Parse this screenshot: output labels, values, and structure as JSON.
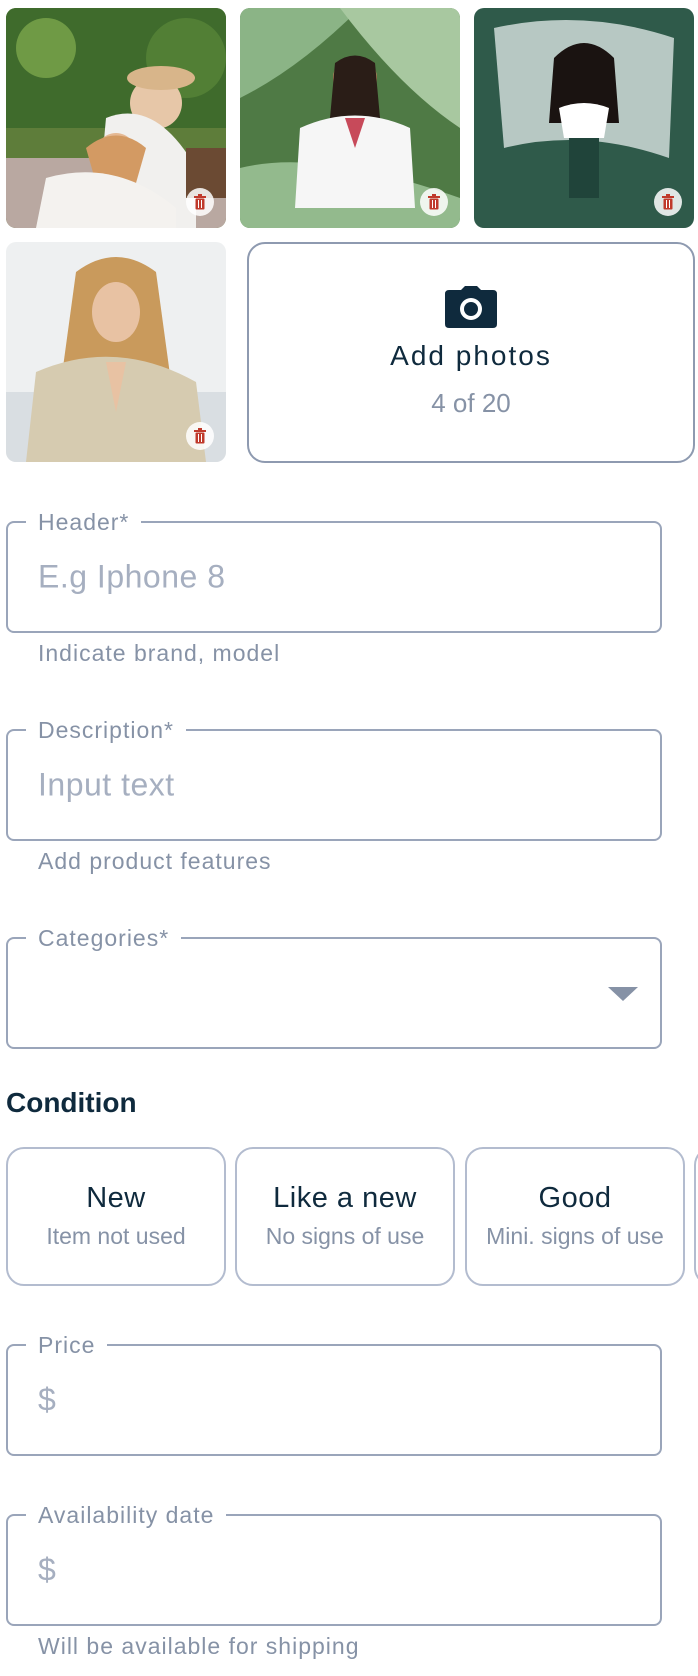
{
  "photos": [
    {
      "alt": "two women picnic",
      "delete_icon": "trash-icon"
    },
    {
      "alt": "woman in white shirt among leaves",
      "delete_icon": "trash-icon"
    },
    {
      "alt": "woman floating in water",
      "delete_icon": "trash-icon"
    },
    {
      "alt": "woman in beige blouse",
      "delete_icon": "trash-icon"
    }
  ],
  "add_photos": {
    "icon": "camera-icon",
    "label": "Add photos",
    "count": "4 of 20"
  },
  "fields": {
    "header": {
      "label": "Header*",
      "placeholder": "E.g Iphone 8",
      "helper": "Indicate brand, model"
    },
    "description": {
      "label": "Description*",
      "placeholder": "Input text",
      "helper": "Add product features"
    },
    "categories": {
      "label": "Categories*",
      "value": "",
      "icon": "chevron-down-icon"
    },
    "price": {
      "label": "Price",
      "placeholder": "$"
    },
    "availability": {
      "label": "Availability date",
      "placeholder": "$",
      "helper": "Will be available for shipping"
    }
  },
  "condition": {
    "title": "Condition",
    "options": [
      {
        "title": "New",
        "subtitle": "Item not used"
      },
      {
        "title": "Like a new",
        "subtitle": "No signs of use"
      },
      {
        "title": "Good",
        "subtitle": "Mini. signs of use"
      }
    ]
  },
  "colors": {
    "primary_text": "#0f2a3d",
    "muted_text": "#8692a6",
    "border": "#9aa5ba",
    "delete": "#c0392b"
  }
}
